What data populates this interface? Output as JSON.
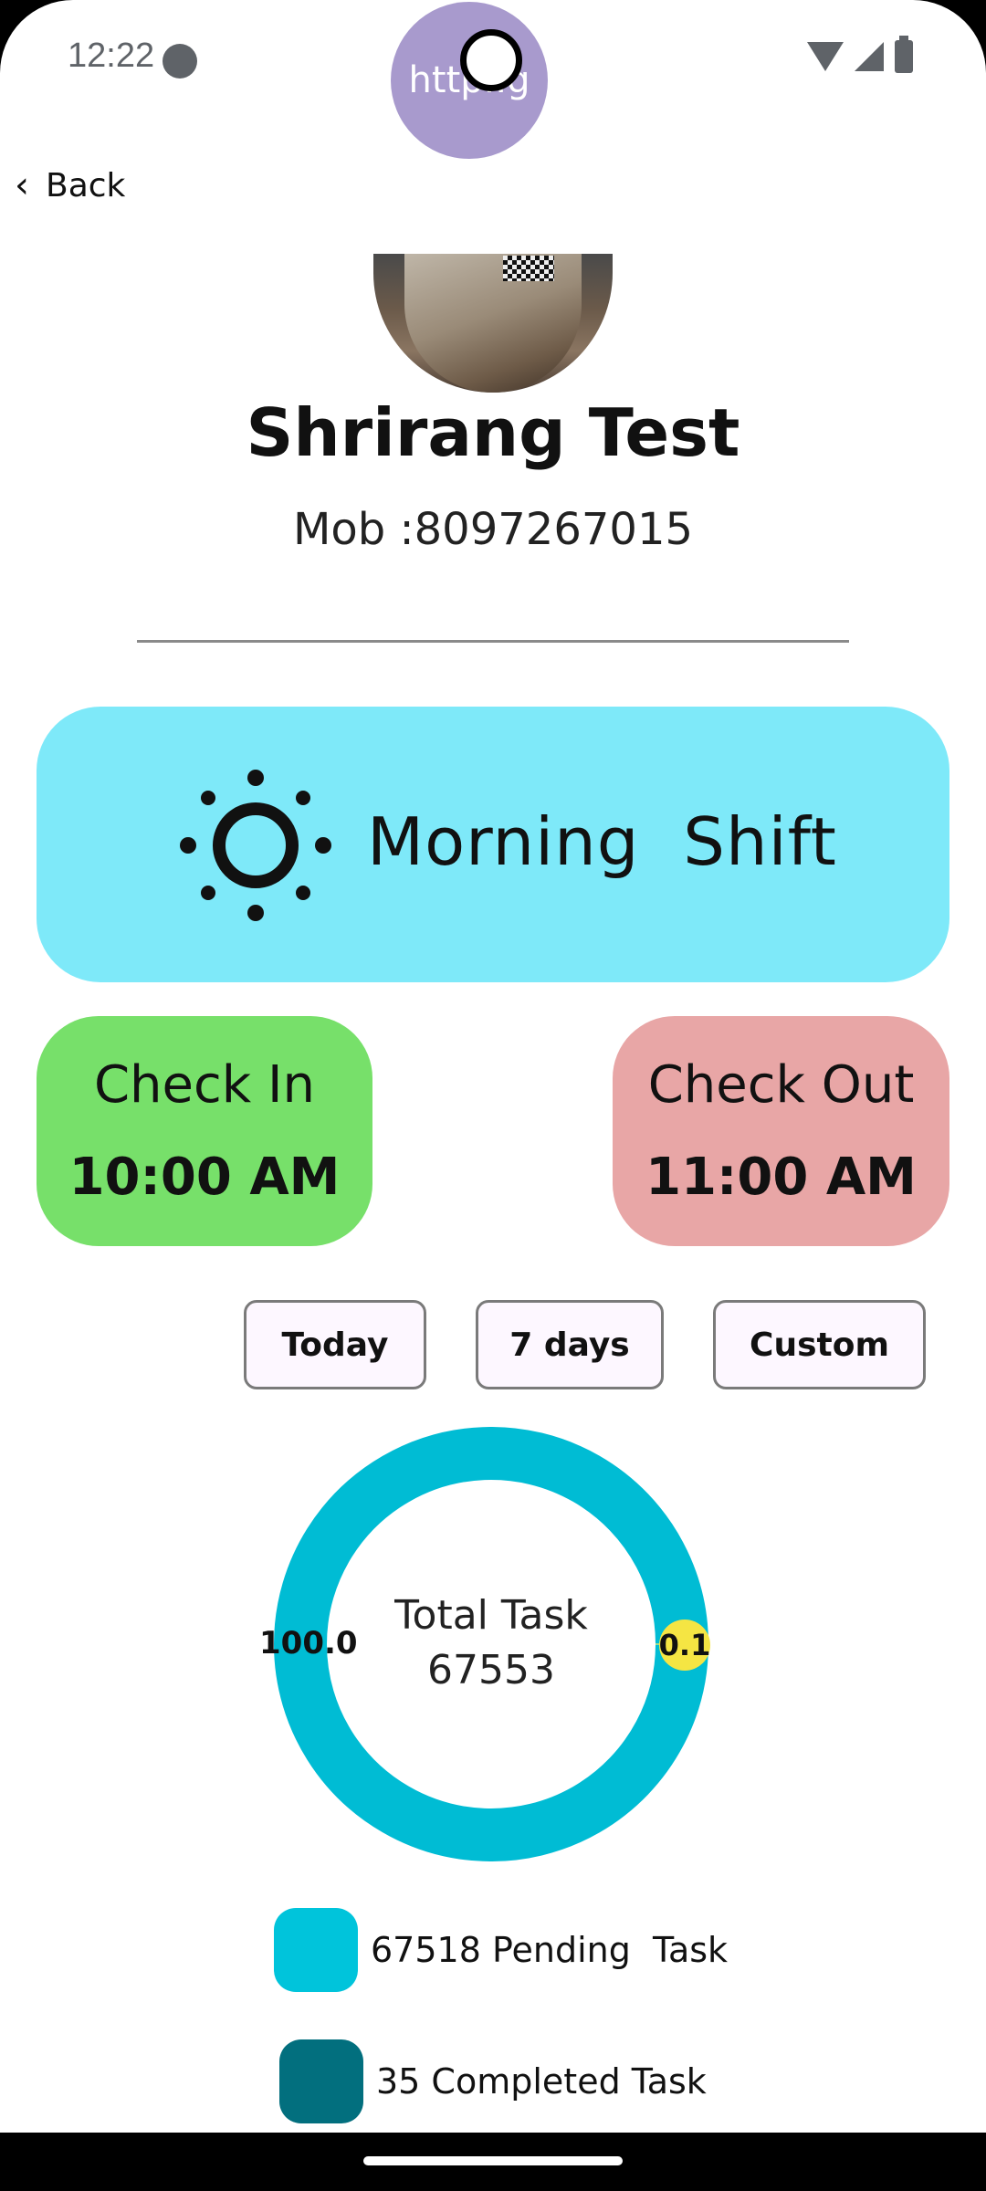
{
  "status_bar": {
    "time": "12:22",
    "icons": [
      "wifi-icon",
      "signal-icon",
      "battery-icon"
    ]
  },
  "bubble": {
    "text": "http..g"
  },
  "nav": {
    "back_label": "Back"
  },
  "profile": {
    "name": "Shrirang Test",
    "mobile": "Mob :8097267015"
  },
  "shift": {
    "label": "Morning  Shift",
    "icon": "sun-icon",
    "color": "#7ee9f9"
  },
  "check_in": {
    "title": "Check In",
    "time": "10:00 AM",
    "color": "#77e06a"
  },
  "check_out": {
    "title": "Check Out",
    "time": "11:00 AM",
    "color": "#e8a6a6"
  },
  "filters": {
    "today": "Today",
    "seven_days": "7 days",
    "custom": "Custom"
  },
  "chart_data": {
    "type": "pie",
    "center_title": "Total Task",
    "center_value": "67553",
    "slices": [
      {
        "label": "100.0",
        "value": 99.9,
        "color": "#00bcd4"
      },
      {
        "label": "0.1",
        "value": 0.1,
        "color": "#f5e543"
      }
    ]
  },
  "legend": {
    "pending": {
      "label": "67518 Pending  Task",
      "color": "#00c4db"
    },
    "completed": {
      "label": "35 Completed Task",
      "color": "#026f7e"
    }
  }
}
